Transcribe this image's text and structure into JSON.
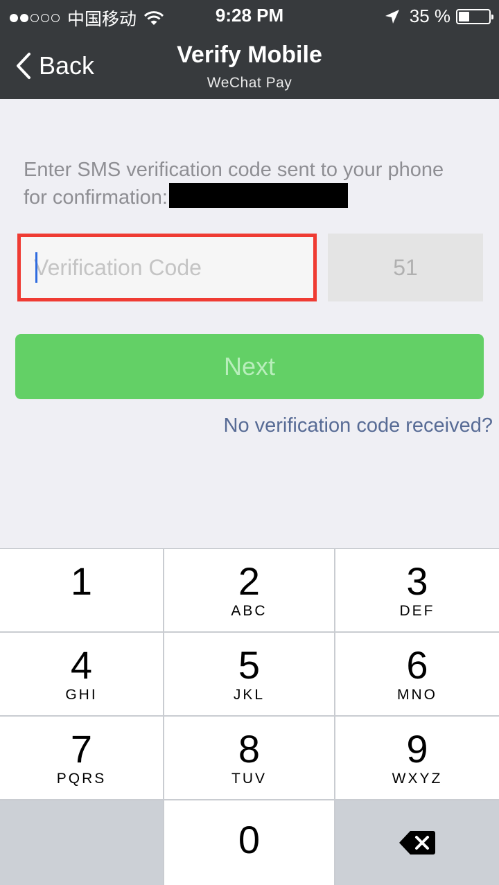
{
  "status_bar": {
    "carrier": "中国移动",
    "time": "9:28 PM",
    "battery_percent": "35 %",
    "battery_level": 0.35,
    "signal_bars_filled": 2,
    "signal_bars_total": 5
  },
  "nav": {
    "back_label": "Back",
    "title": "Verify Mobile",
    "subtitle": "WeChat Pay"
  },
  "form": {
    "instruction": "Enter SMS verification code sent to your phone for confirmation:",
    "code_placeholder": "Verification Code",
    "code_value": "",
    "countdown": "51",
    "next_label": "Next",
    "no_code_link": "No verification code received?"
  },
  "colors": {
    "nav_bg": "#373a3d",
    "highlight_border": "#ef3b33",
    "next_button": "#63d066",
    "link": "#576b95"
  },
  "keypad": {
    "keys": [
      {
        "num": "1",
        "letters": ""
      },
      {
        "num": "2",
        "letters": "ABC"
      },
      {
        "num": "3",
        "letters": "DEF"
      },
      {
        "num": "4",
        "letters": "GHI"
      },
      {
        "num": "5",
        "letters": "JKL"
      },
      {
        "num": "6",
        "letters": "MNO"
      },
      {
        "num": "7",
        "letters": "PQRS"
      },
      {
        "num": "8",
        "letters": "TUV"
      },
      {
        "num": "9",
        "letters": "WXYZ"
      },
      {
        "num": "0",
        "letters": ""
      }
    ],
    "backspace_icon": "backspace-icon"
  }
}
